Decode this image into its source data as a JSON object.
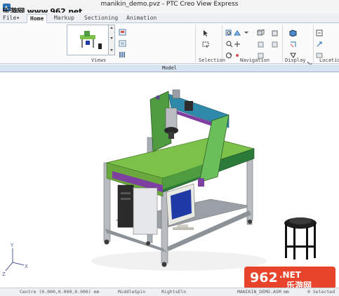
{
  "window": {
    "title": "manikin_demo.pvz - PTC Creo View Express",
    "watermark_top": "乐游网 www.962.net"
  },
  "tabs": [
    {
      "label": "File",
      "suffix": "▾"
    },
    {
      "label": "Home"
    },
    {
      "label": "Markup"
    },
    {
      "label": "Sectioning"
    },
    {
      "label": "Animation"
    }
  ],
  "ribbon": {
    "groups": [
      {
        "label": "Views"
      },
      {
        "label": "Selection"
      },
      {
        "label": "Navigation"
      },
      {
        "label": "Display"
      },
      {
        "label": "Location"
      }
    ]
  },
  "model": {
    "header": "Model"
  },
  "axes": {
    "x": "X",
    "y": "Y",
    "z": "Z"
  },
  "status": {
    "left": "Centre (0.000,0.000,0.000) mm",
    "middle": "MiddleSpin",
    "right_mouse": "RightsEln",
    "model_name": "MANIKIN_DEMO.ASM",
    "units": "mm",
    "selected": "0 Selected"
  },
  "watermark_bottom": {
    "brand": "962",
    "suffix": ".NET",
    "cn": "乐游网"
  },
  "colors": {
    "table_top": "#7cc24a",
    "frame": "#9aa0a6",
    "accent_purple": "#7d3fa0",
    "gantry_green": "#4f9b3f",
    "monitor_blue": "#1f3aa5"
  }
}
